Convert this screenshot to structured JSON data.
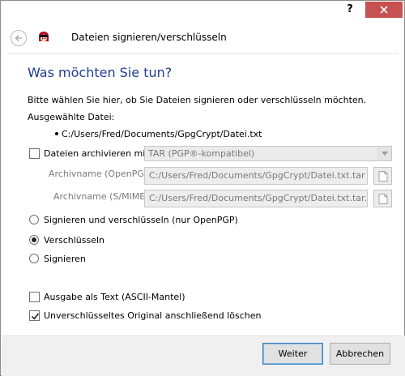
{
  "titlebar": {
    "help_label": "?",
    "close_icon": "close-icon"
  },
  "header": {
    "title": "Dateien signieren/verschlüsseln",
    "app_icon": "kleopatra-app-icon",
    "back_icon": "arrow-left-icon"
  },
  "main": {
    "heading": "Was möchten Sie tun?",
    "intro": "Bitte wählen Sie hier, ob Sie Dateien signieren oder verschlüsseln möchten.",
    "selected_file_label": "Ausgewählte Datei:",
    "selected_file": "C:/Users/Fred/Documents/GpgCrypt/Datei.txt",
    "archive": {
      "checkbox_label": "Dateien archivieren mit:",
      "checked": false,
      "format_selected": "TAR (PGP®-kompatibel)",
      "openpgp_label": "Archivname (OpenPGP):",
      "openpgp_value": "C:/Users/Fred/Documents/GpgCrypt/Datei.txt.tar",
      "smime_label": "Archivname (S/MIME):",
      "smime_value": "C:/Users/Fred/Documents/GpgCrypt/Datei.txt.tar.gz"
    },
    "options": [
      {
        "label": "Signieren und verschlüsseln (nur OpenPGP)",
        "selected": false
      },
      {
        "label": "Verschlüsseln",
        "selected": true
      },
      {
        "label": "Signieren",
        "selected": false
      }
    ],
    "ascii_armor": {
      "label": "Ausgabe als Text (ASCII-Mantel)",
      "checked": false
    },
    "delete_original": {
      "label": "Unverschlüsseltes Original anschließend löschen",
      "checked": true
    }
  },
  "footer": {
    "next_label": "Weiter",
    "cancel_label": "Abbrechen"
  }
}
